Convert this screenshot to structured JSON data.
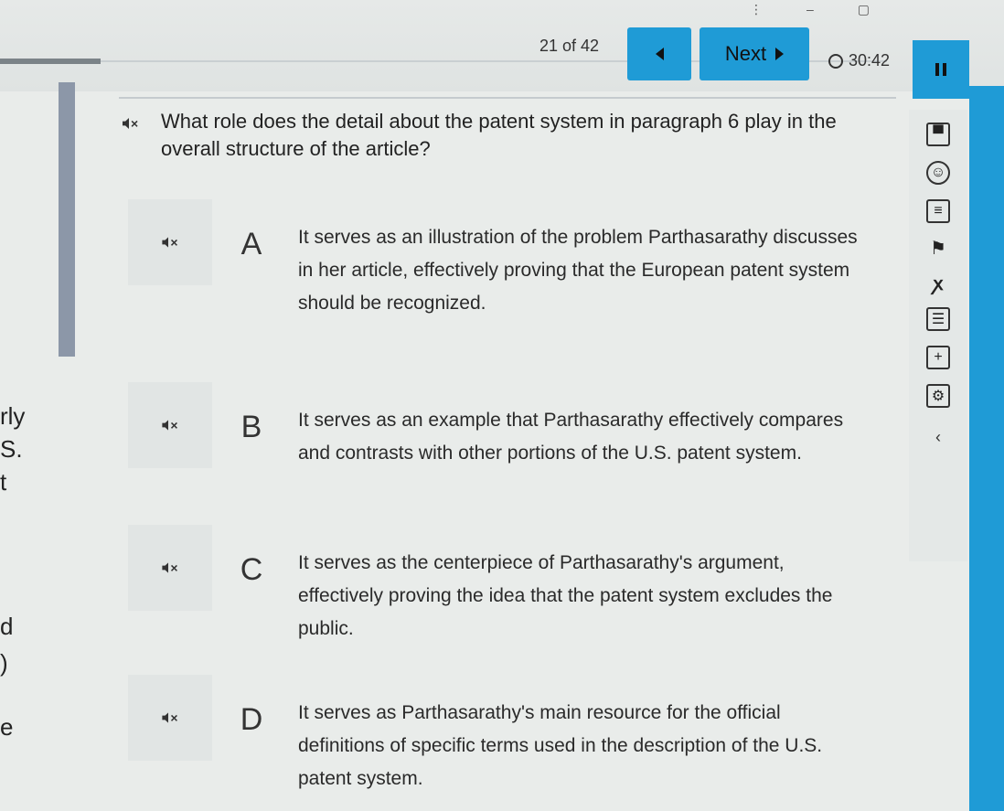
{
  "header": {
    "counter": "21 of 42",
    "next_label": "Next",
    "timer": "30:42"
  },
  "passage_fragments": [
    "rly",
    "S.",
    "t",
    "d",
    ")",
    "e"
  ],
  "question": {
    "text": "What role does the detail about the patent system in paragraph 6 play in the overall structure of the article?"
  },
  "answers": [
    {
      "letter": "A",
      "text": "It serves as an illustration of the problem Parthasarathy discusses in her article, effectively proving that the European patent system should be recognized."
    },
    {
      "letter": "B",
      "text": "It serves as an example that Parthasarathy effectively compares and contrasts with other portions of the U.S. patent system."
    },
    {
      "letter": "C",
      "text": "It serves as the centerpiece of Parthasarathy's argument, effectively proving the idea that the patent system excludes the public."
    },
    {
      "letter": "D",
      "text": "It serves as Parthasarathy's main resource for the official definitions of specific terms used in the description of the U.S. patent system."
    }
  ],
  "tools": [
    "save-icon",
    "accessibility-icon",
    "calculator-icon",
    "flag-icon",
    "strikethrough-icon",
    "notes-icon",
    "add-icon",
    "settings-icon",
    "collapse-icon"
  ],
  "colors": {
    "accent": "#1f9bd6"
  }
}
